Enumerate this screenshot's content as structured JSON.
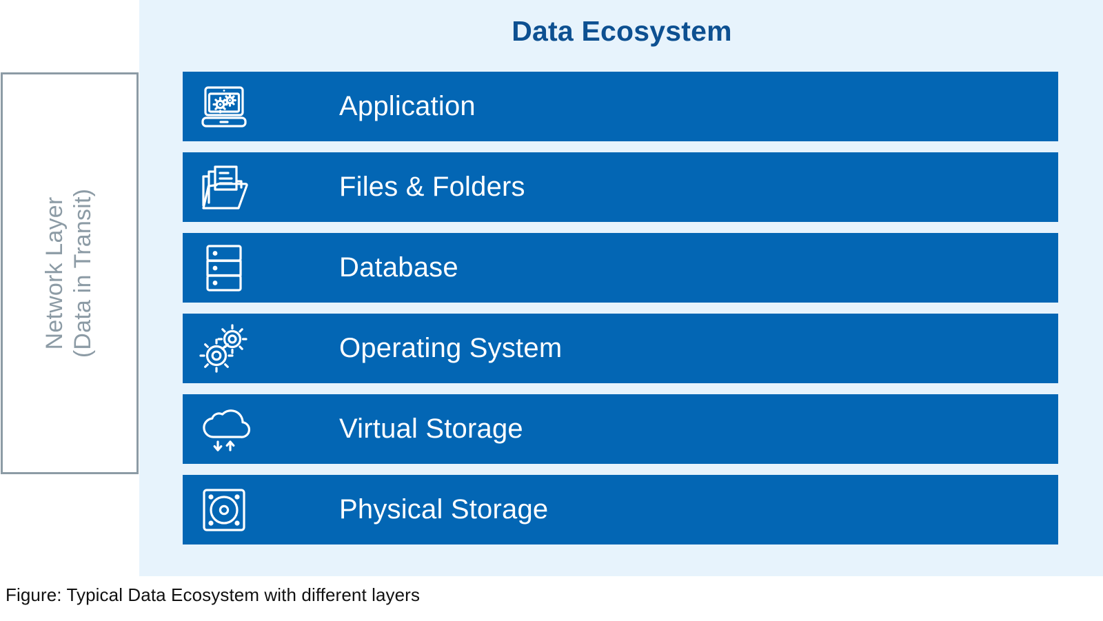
{
  "figure": {
    "caption": "Figure: Typical Data Ecosystem with different layers",
    "title": "Data Ecosystem"
  },
  "network_layer": {
    "line1": "Network Layer",
    "line2": "(Data in Transit)"
  },
  "colors": {
    "panel_background": "#e7f3fc",
    "layer_bar": "#0366b4",
    "title_text": "#0d5091",
    "layer_label_text": "#ffffff",
    "network_panel_border": "#8c9ba5",
    "network_panel_text": "#8c9ba5",
    "caption_text": "#111111"
  },
  "layers": [
    {
      "label": "Application",
      "icon": "laptop-gears-icon"
    },
    {
      "label": "Files & Folders",
      "icon": "folder-documents-icon"
    },
    {
      "label": "Database",
      "icon": "server-rack-icon"
    },
    {
      "label": "Operating System",
      "icon": "gears-icon"
    },
    {
      "label": "Virtual Storage",
      "icon": "cloud-sync-icon"
    },
    {
      "label": "Physical Storage",
      "icon": "hard-disk-icon"
    }
  ]
}
